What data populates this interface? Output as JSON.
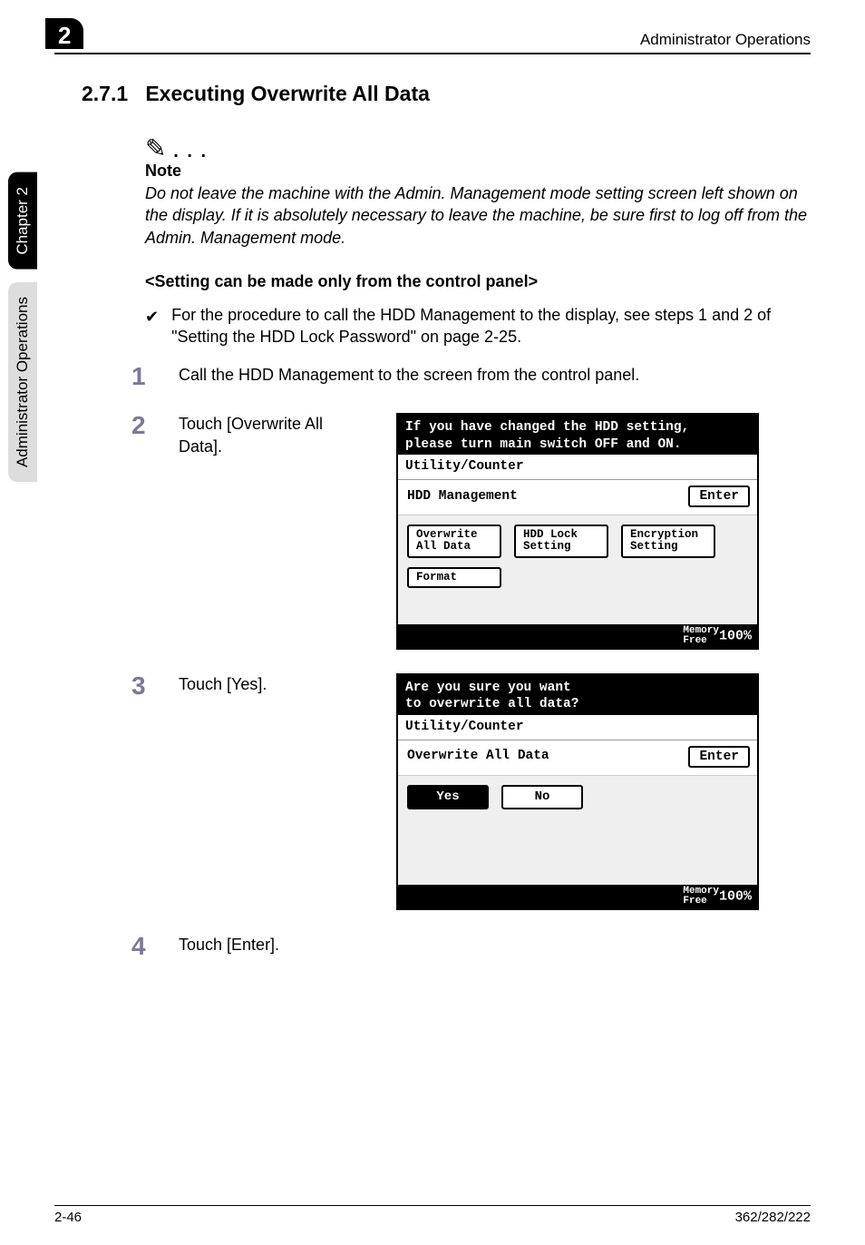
{
  "header": {
    "chapter_box": "2",
    "title": "Administrator Operations"
  },
  "side_tabs": {
    "dark": "Chapter 2",
    "light": "Administrator Operations"
  },
  "section": {
    "number": "2.7.1",
    "title": "Executing Overwrite All Data"
  },
  "note": {
    "label": "Note",
    "text": "Do not leave the machine with the Admin. Management mode setting screen left shown on the display. If it is absolutely necessary to leave the machine, be sure first to log off from the Admin. Management mode."
  },
  "subhead": "<Setting can be made only from the control panel>",
  "check": "For the procedure to call the HDD Management to the display, see steps 1 and 2 of \"Setting the HDD Lock Password\" on page 2-25.",
  "steps": {
    "s1": {
      "num": "1",
      "text": "Call the HDD Management to the screen from the control panel."
    },
    "s2": {
      "num": "2",
      "text": "Touch [Overwrite All Data]."
    },
    "s3": {
      "num": "3",
      "text": "Touch [Yes]."
    },
    "s4": {
      "num": "4",
      "text": "Touch [Enter]."
    }
  },
  "panel1": {
    "header_line1": "If you have changed the HDD setting,",
    "header_line2": "please turn main switch OFF and ON.",
    "breadcrumb": "Utility/Counter",
    "title": "HDD Management",
    "enter": "Enter",
    "buttons": {
      "overwrite": "Overwrite\nAll Data",
      "hdd_lock": "HDD Lock\nSetting",
      "encryption": "Encryption\nSetting",
      "format": "Format"
    },
    "footer_label": "Memory\nFree",
    "footer_value": "100%"
  },
  "panel2": {
    "header_line1": "Are you sure you want",
    "header_line2": "to overwrite all data?",
    "breadcrumb": "Utility/Counter",
    "title": "Overwrite All Data",
    "enter": "Enter",
    "buttons": {
      "yes": "Yes",
      "no": "No"
    },
    "footer_label": "Memory\nFree",
    "footer_value": "100%"
  },
  "footer": {
    "left": "2-46",
    "right": "362/282/222"
  }
}
